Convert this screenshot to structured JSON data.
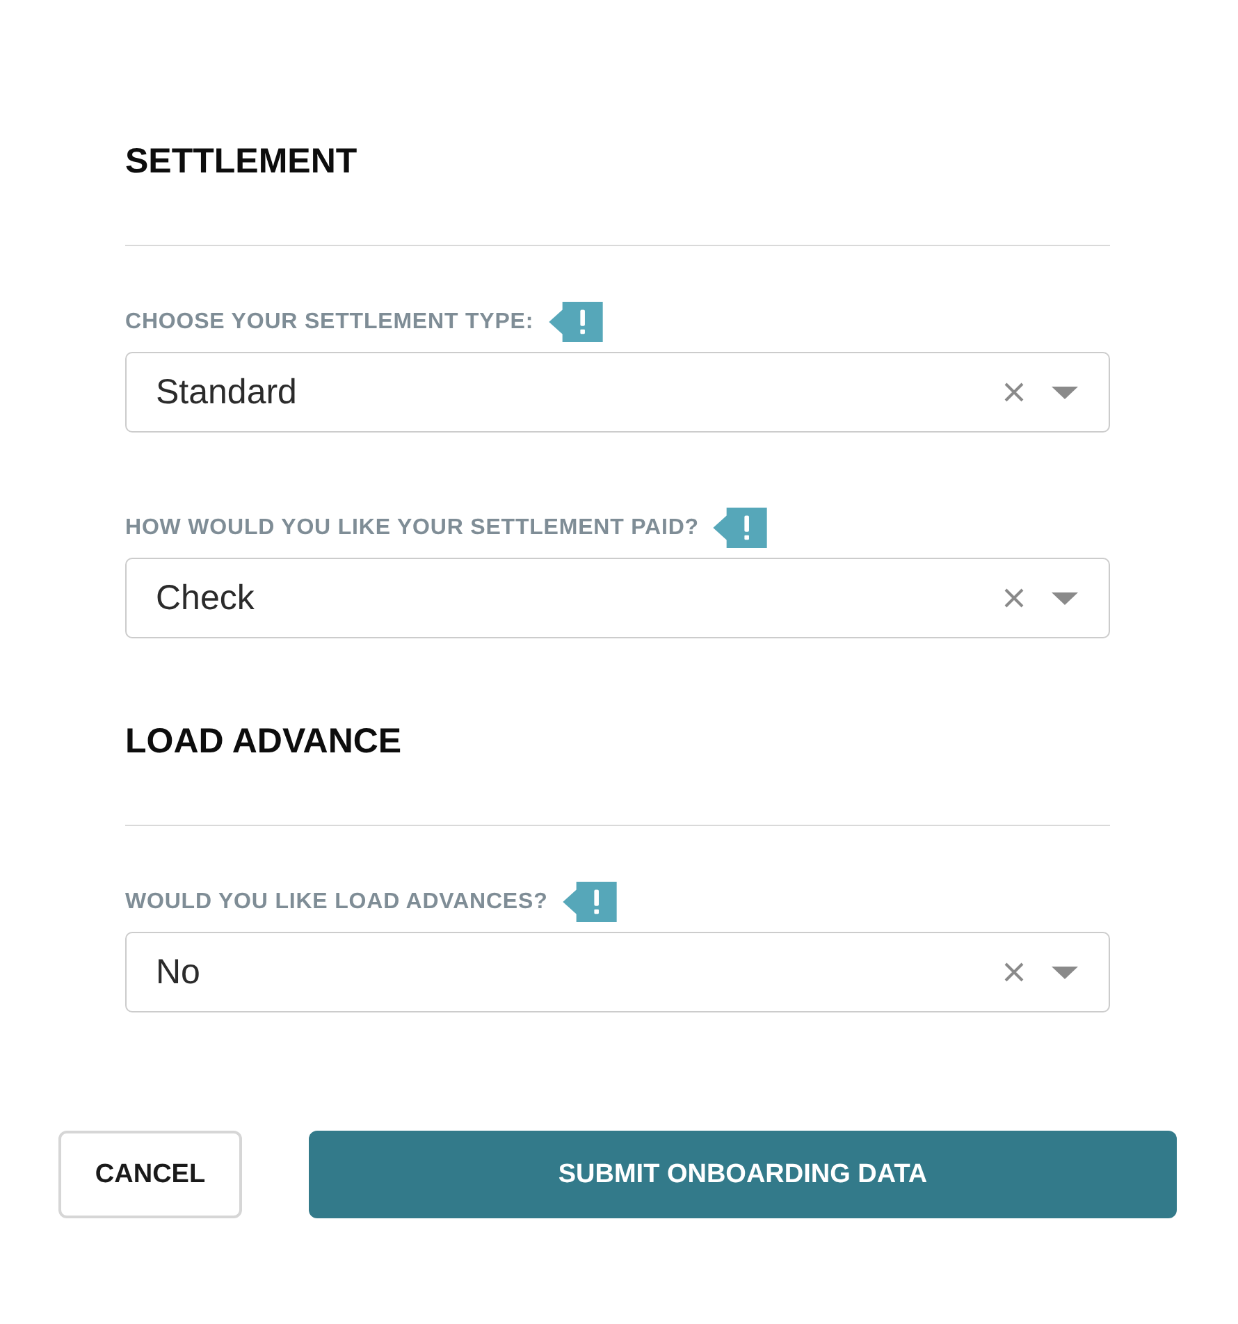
{
  "sections": [
    {
      "title": "SETTLEMENT",
      "fields": [
        {
          "label": "CHOOSE YOUR SETTLEMENT TYPE:",
          "required": true,
          "value": "Standard"
        },
        {
          "label": "HOW WOULD YOU LIKE YOUR SETTLEMENT PAID?",
          "required": true,
          "value": "Check"
        }
      ]
    },
    {
      "title": "LOAD ADVANCE",
      "fields": [
        {
          "label": "WOULD YOU LIKE LOAD ADVANCES?",
          "required": true,
          "value": "No"
        }
      ]
    }
  ],
  "buttons": [
    {
      "label": "CANCEL",
      "kind": "secondary"
    },
    {
      "label": "SUBMIT ONBOARDING DATA",
      "kind": "primary"
    }
  ]
}
